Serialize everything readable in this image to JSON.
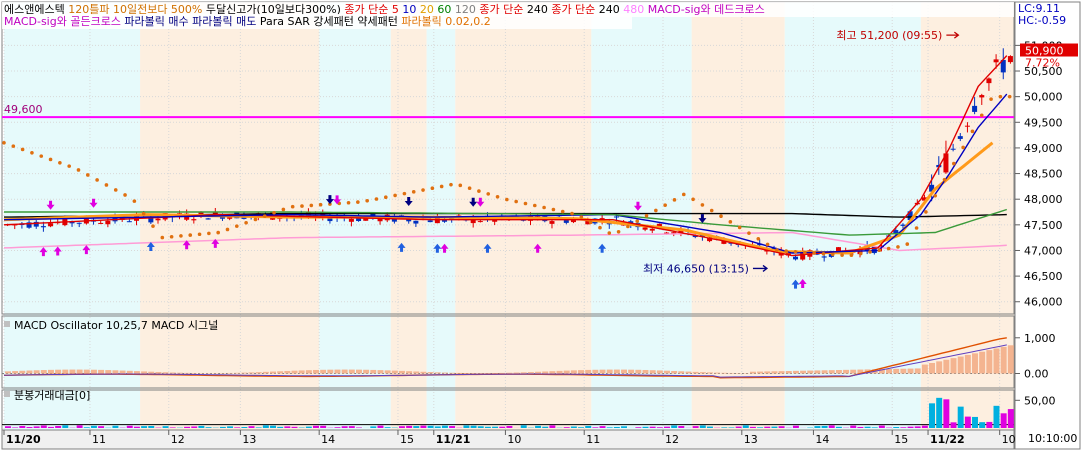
{
  "legend": {
    "row1": [
      {
        "text": "에스앤에스텍",
        "color": "#000000"
      },
      {
        "text": "120틀파 10일전보다 500%",
        "color": "#d07000"
      },
      {
        "text": "두달신고가(10일보다300%)",
        "color": "#000000"
      },
      {
        "text": "종가 단순 5",
        "color": "#e00000"
      },
      {
        "text": "10",
        "color": "#0000c0"
      },
      {
        "text": "20",
        "color": "#e0a000"
      },
      {
        "text": "60",
        "color": "#008000"
      },
      {
        "text": "120",
        "color": "#808080"
      },
      {
        "text": "종가 단순",
        "color": "#e00000"
      },
      {
        "text": "240",
        "color": "#000000"
      },
      {
        "text": "종가 단순",
        "color": "#e00000"
      },
      {
        "text": "240",
        "color": "#000000"
      },
      {
        "text": "480",
        "color": "#ff80ff"
      },
      {
        "text": "MACD-sig와 데드크로스",
        "color": "#c000c0"
      }
    ],
    "row2": [
      {
        "text": "MACD-sig와 골든크로스",
        "color": "#c000c0"
      },
      {
        "text": "파라볼릭 매수",
        "color": "#000080"
      },
      {
        "text": "파라볼릭 매도",
        "color": "#000080"
      },
      {
        "text": "Para SAR 강세패턴",
        "color": "#000000"
      },
      {
        "text": "약세패턴",
        "color": "#000000"
      },
      {
        "text": "파라볼릭 0.02,0.2",
        "color": "#e07000"
      }
    ],
    "lc": "LC:9.11",
    "hc": "HC:-0.59"
  },
  "chart_data": [
    {
      "type": "candlestick",
      "name": "price",
      "ylim": [
        45800,
        51300
      ],
      "y_ticks": [
        46000,
        46500,
        47000,
        47500,
        48000,
        48500,
        49000,
        49500,
        50000,
        50500,
        51000
      ],
      "y_tick_labels": [
        "46,000",
        "46,500",
        "47,000",
        "47,500",
        "48,000",
        "48,500",
        "49,000",
        "49,500",
        "50,000",
        "50,500",
        "51,000"
      ],
      "current_price": 50900,
      "current_label": "50,900",
      "change_label": "7.72%",
      "horizontal_line": {
        "value": 49600,
        "label": "49,600",
        "color": "#ff00ff"
      },
      "annotations": [
        {
          "text": "최고 51,200 (09:55)",
          "x": 131,
          "y": 51200,
          "color": "#c00000"
        },
        {
          "text": "최저 46,650 (13:15)",
          "x": 104,
          "y": 46650,
          "color": "#000080"
        }
      ],
      "overlay_lines": {
        "ma_black_240": {
          "color": "#000000",
          "points": [
            [
              0,
              47650
            ],
            [
              40,
              47720
            ],
            [
              80,
              47720
            ],
            [
              110,
              47720
            ],
            [
              125,
              47650
            ],
            [
              140,
              47700
            ]
          ]
        },
        "ma_pink_480": {
          "color": "#ff9cd6",
          "points": [
            [
              0,
              47050
            ],
            [
              40,
              47250
            ],
            [
              80,
              47300
            ],
            [
              110,
              47350
            ],
            [
              125,
              47000
            ],
            [
              140,
              47100
            ]
          ]
        },
        "ma_orange_20": {
          "color": "#ff9a1a",
          "points": [
            [
              0,
              47600
            ],
            [
              20,
              47700
            ],
            [
              40,
              47650
            ],
            [
              60,
              47650
            ],
            [
              80,
              47620
            ],
            [
              95,
              47400
            ],
            [
              108,
              46980
            ],
            [
              118,
              46950
            ],
            [
              125,
              47300
            ],
            [
              130,
              48200
            ],
            [
              138,
              49100
            ]
          ]
        },
        "ma_red_5": {
          "color": "#e00000",
          "points": [
            [
              0,
              47500
            ],
            [
              30,
              47700
            ],
            [
              60,
              47600
            ],
            [
              85,
              47600
            ],
            [
              100,
              47200
            ],
            [
              110,
              46900
            ],
            [
              122,
              47050
            ],
            [
              128,
              48000
            ],
            [
              132,
              49000
            ],
            [
              136,
              50200
            ],
            [
              140,
              50800
            ]
          ]
        },
        "ma_blue_10": {
          "color": "#0000c0",
          "points": [
            [
              0,
              47600
            ],
            [
              40,
              47700
            ],
            [
              60,
              47650
            ],
            [
              85,
              47700
            ],
            [
              100,
              47350
            ],
            [
              110,
              46950
            ],
            [
              122,
              47000
            ],
            [
              128,
              47700
            ],
            [
              132,
              48500
            ],
            [
              136,
              49400
            ],
            [
              140,
              50050
            ]
          ]
        },
        "ma_green_60": {
          "color": "#3a9a3a",
          "points": [
            [
              0,
              47750
            ],
            [
              40,
              47750
            ],
            [
              85,
              47700
            ],
            [
              100,
              47500
            ],
            [
              118,
              47300
            ],
            [
              130,
              47350
            ],
            [
              140,
              47800
            ]
          ]
        },
        "sar_orange_dots": {
          "color": "#e07010",
          "points": [
            [
              0,
              49100
            ],
            [
              10,
              48600
            ],
            [
              18,
              48000
            ],
            [
              22,
              47250
            ],
            [
              30,
              47350
            ],
            [
              40,
              47850
            ],
            [
              50,
              47950
            ],
            [
              63,
              48300
            ],
            [
              70,
              48000
            ],
            [
              80,
              47700
            ],
            [
              85,
              47300
            ],
            [
              95,
              48100
            ],
            [
              108,
              47000
            ],
            [
              118,
              46900
            ],
            [
              126,
              47100
            ],
            [
              138,
              50000
            ]
          ]
        }
      },
      "arrows": [
        {
          "x": 6,
          "dir": "down",
          "color": "#e000e0"
        },
        {
          "x": 5,
          "dir": "up",
          "color": "#e000e0"
        },
        {
          "x": 7,
          "dir": "up",
          "color": "#e000e0"
        },
        {
          "x": 12,
          "dir": "down",
          "color": "#e000e0"
        },
        {
          "x": 11,
          "dir": "up",
          "color": "#e000e0"
        },
        {
          "x": 20,
          "dir": "up",
          "color": "#2060e0"
        },
        {
          "x": 25,
          "dir": "up",
          "color": "#e000e0"
        },
        {
          "x": 29,
          "dir": "up",
          "color": "#e000e0"
        },
        {
          "x": 45,
          "dir": "down",
          "color": "#000080"
        },
        {
          "x": 46,
          "dir": "down",
          "color": "#e000e0"
        },
        {
          "x": 55,
          "dir": "up",
          "color": "#2060e0"
        },
        {
          "x": 56,
          "dir": "down",
          "color": "#000080"
        },
        {
          "x": 60,
          "dir": "up",
          "color": "#2060e0"
        },
        {
          "x": 61,
          "dir": "up",
          "color": "#e000e0"
        },
        {
          "x": 65,
          "dir": "down",
          "color": "#000080"
        },
        {
          "x": 66,
          "dir": "down",
          "color": "#e000e0"
        },
        {
          "x": 67,
          "dir": "up",
          "color": "#2060e0"
        },
        {
          "x": 74,
          "dir": "up",
          "color": "#e000e0"
        },
        {
          "x": 83,
          "dir": "up",
          "color": "#2060e0"
        },
        {
          "x": 88,
          "dir": "down",
          "color": "#e000e0"
        },
        {
          "x": 97,
          "dir": "down",
          "color": "#000080"
        },
        {
          "x": 110,
          "dir": "up",
          "color": "#2060e0"
        },
        {
          "x": 111,
          "dir": "up",
          "color": "#e000e0"
        }
      ]
    },
    {
      "type": "bar_line",
      "name": "macd",
      "title": "MACD Oscillator 10,25,7  MACD  시그널",
      "ylim": [
        -0.35,
        1.05
      ],
      "y_ticks": [
        0.0,
        1.0
      ],
      "y_tick_labels": [
        "0.00",
        "1,000"
      ]
    },
    {
      "type": "bar",
      "name": "volume",
      "title": "분봉거래대금[0]",
      "ylim": [
        0,
        65
      ],
      "y_ticks": [
        50
      ],
      "y_tick_labels": [
        "50,00"
      ]
    }
  ],
  "x_axis": {
    "labels": [
      {
        "text": "11/20",
        "pos": 0,
        "bold": true
      },
      {
        "text": "11",
        "pos": 12
      },
      {
        "text": "12",
        "pos": 23
      },
      {
        "text": "13",
        "pos": 33
      },
      {
        "text": "14",
        "pos": 44
      },
      {
        "text": "15",
        "pos": 55
      },
      {
        "text": "11/21",
        "pos": 60,
        "bold": true
      },
      {
        "text": "10",
        "pos": 70
      },
      {
        "text": "11",
        "pos": 81
      },
      {
        "text": "12",
        "pos": 92
      },
      {
        "text": "13",
        "pos": 103
      },
      {
        "text": "14",
        "pos": 113
      },
      {
        "text": "15",
        "pos": 124
      },
      {
        "text": "11/22",
        "pos": 129,
        "bold": true
      },
      {
        "text": "10",
        "pos": 139
      }
    ],
    "time_label": "10:10:00"
  },
  "bands": [
    {
      "start": 0,
      "end": 19,
      "color": "#e6fafb"
    },
    {
      "start": 19,
      "end": 44,
      "color": "#fdefe0"
    },
    {
      "start": 44,
      "end": 54,
      "color": "#e6fafb"
    },
    {
      "start": 54,
      "end": 59,
      "color": "#fdefe0"
    },
    {
      "start": 59,
      "end": 63,
      "color": "#e6fafb"
    },
    {
      "start": 63,
      "end": 82,
      "color": "#fdefe0"
    },
    {
      "start": 82,
      "end": 96,
      "color": "#e6fafb"
    },
    {
      "start": 96,
      "end": 109,
      "color": "#fdefe0"
    },
    {
      "start": 109,
      "end": 128,
      "color": "#e6fafb"
    },
    {
      "start": 128,
      "end": 141,
      "color": "#fdefe0"
    }
  ]
}
